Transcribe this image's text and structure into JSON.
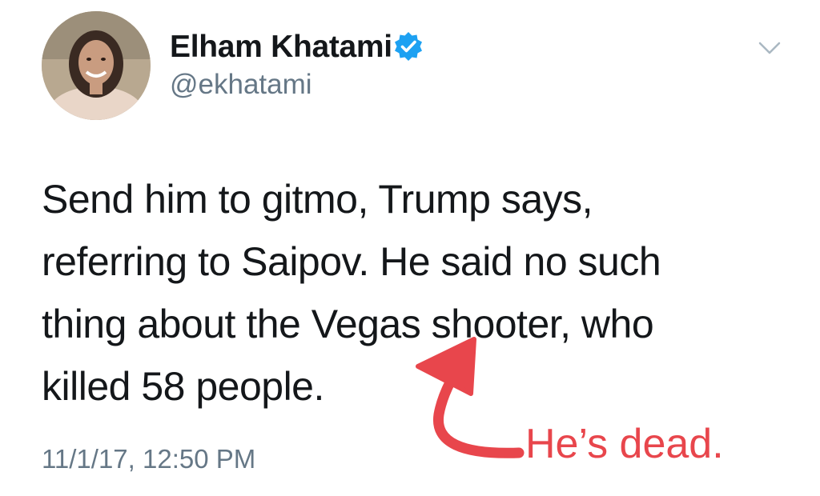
{
  "tweet": {
    "author": {
      "name": "Elham Khatami",
      "handle": "@ekhatami",
      "verified_icon": "verified-badge-icon",
      "avatar_icon": "profile-photo"
    },
    "menu_icon": "chevron-down-icon",
    "text_lines": [
      "Send him to gitmo, Trump says,",
      "referring to Saipov. He said no such",
      "thing about the Vegas shooter, who",
      "killed 58 people."
    ],
    "timestamp": "11/1/17, 12:50 PM"
  },
  "annotation": {
    "text": "He’s dead.",
    "color": "#e8464c",
    "arrow_icon": "curved-arrow-icon"
  },
  "colors": {
    "verified_blue": "#1da1f2",
    "secondary_text": "#657786",
    "primary_text": "#14171a"
  }
}
